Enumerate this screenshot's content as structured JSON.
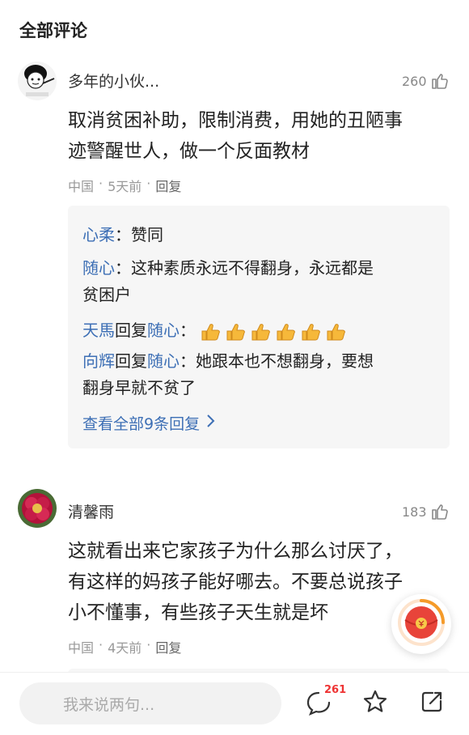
{
  "section": {
    "title": "全部评论"
  },
  "comments": [
    {
      "username": "多年的小伙...",
      "likes": "260",
      "text_lines": [
        "取消贫困补助，限制消费，用她的丑陋事",
        "迹警醒世人，做一个反面教材"
      ],
      "location": "中国",
      "time": "5天前",
      "reply_label": "回复",
      "replies": [
        {
          "user": "心柔",
          "sep": "：",
          "text": "赞同"
        },
        {
          "user": "随心",
          "sep": "：",
          "text": "这种素质永远不得翻身，永远都是",
          "text2": "贫困户"
        },
        {
          "user": "天馬",
          "reply_word": "回复",
          "target": "随心",
          "sep": "："
        },
        {
          "user": "向辉",
          "reply_word": "回复",
          "target": "随心",
          "sep": "：",
          "text": "她跟本也不想翻身，要想",
          "text2": "翻身早就不贫了"
        }
      ],
      "view_all": "查看全部9条回复"
    },
    {
      "username": "清馨雨",
      "likes": "183",
      "text_lines": [
        "这就看出来它家孩子为什么那么讨厌了，",
        "有这样的妈孩子能好哪去。不要总说孩子",
        "小不懂事，有些孩子天生就是坏"
      ],
      "location": "中国",
      "time": "4天前",
      "reply_label": "回复"
    }
  ],
  "bottom_bar": {
    "input_placeholder": "我来说两句...",
    "comment_count": "261"
  },
  "icons": [
    "thumbs-up-icon",
    "thumbs-up-emoji-icon",
    "chevron-right-icon",
    "comment-bubble-icon",
    "star-icon",
    "share-icon",
    "red-envelope-icon"
  ],
  "colors": {
    "link": "#3d6fb5",
    "badge": "#e33333",
    "reply_bg": "#f6f6f6"
  }
}
